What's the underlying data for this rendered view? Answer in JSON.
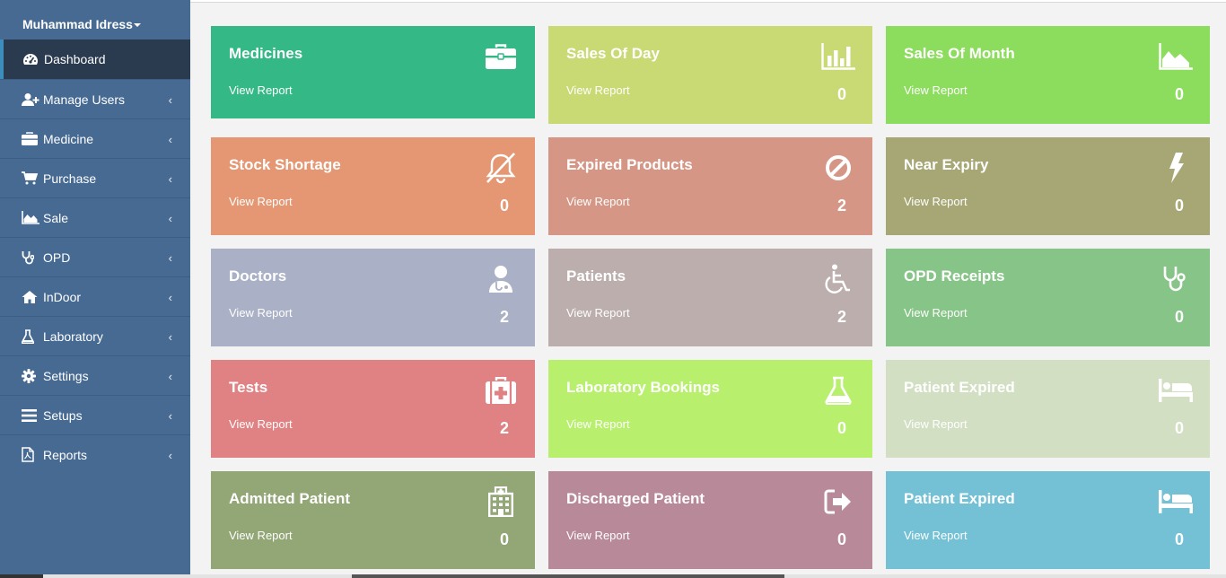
{
  "sidebar": {
    "user_name": "Muhammad Idress",
    "items": [
      {
        "label": "Dashboard",
        "icon": "dashboard-icon"
      },
      {
        "label": "Manage Users",
        "icon": "user-plus-icon"
      },
      {
        "label": "Medicine",
        "icon": "briefcase-icon"
      },
      {
        "label": "Purchase",
        "icon": "cart-icon"
      },
      {
        "label": "Sale",
        "icon": "area-chart-icon"
      },
      {
        "label": "OPD",
        "icon": "stethoscope-icon"
      },
      {
        "label": "InDoor",
        "icon": "home-icon"
      },
      {
        "label": "Laboratory",
        "icon": "flask-icon"
      },
      {
        "label": "Settings",
        "icon": "gear-icon"
      },
      {
        "label": "Setups",
        "icon": "bars-icon"
      },
      {
        "label": "Reports",
        "icon": "pdf-file-icon"
      }
    ]
  },
  "tiles": [
    {
      "title": "Medicines",
      "link": "View Report",
      "value": "",
      "color": "#33b886",
      "icon": "medkit-icon"
    },
    {
      "title": "Sales Of Day",
      "link": "View Report",
      "value": "0",
      "color": "#c9d974",
      "icon": "bar-chart-icon"
    },
    {
      "title": "Sales Of Month",
      "link": "View Report",
      "value": "0",
      "color": "#8cdc5e",
      "icon": "area-chart-icon"
    },
    {
      "title": "Stock Shortage",
      "link": "View Report",
      "value": "0",
      "color": "#e49772",
      "icon": "bell-slash-icon"
    },
    {
      "title": "Expired Products",
      "link": "View Report",
      "value": "2",
      "color": "#d59685",
      "icon": "ban-icon"
    },
    {
      "title": "Near Expiry",
      "link": "View Report",
      "value": "0",
      "color": "#a6a774",
      "icon": "bolt-icon"
    },
    {
      "title": "Doctors",
      "link": "View Report",
      "value": "2",
      "color": "#aab0c5",
      "icon": "user-md-icon"
    },
    {
      "title": "Patients",
      "link": "View Report",
      "value": "2",
      "color": "#bbaeac",
      "icon": "wheelchair-icon"
    },
    {
      "title": "OPD Receipts",
      "link": "View Report",
      "value": "0",
      "color": "#86c587",
      "icon": "stethoscope-icon"
    },
    {
      "title": "Tests",
      "link": "View Report",
      "value": "2",
      "color": "#e08283",
      "icon": "first-aid-icon"
    },
    {
      "title": "Laboratory Bookings",
      "link": "View Report",
      "value": "0",
      "color": "#b8f06e",
      "icon": "flask-icon"
    },
    {
      "title": "Patient Expired",
      "link": "View Report",
      "value": "0",
      "color": "#d2dfc3",
      "icon": "bed-icon"
    },
    {
      "title": "Admitted Patient",
      "link": "View Report",
      "value": "0",
      "color": "#92a676",
      "icon": "hospital-icon"
    },
    {
      "title": "Discharged Patient",
      "link": "View Report",
      "value": "0",
      "color": "#b88a99",
      "icon": "sign-out-icon"
    },
    {
      "title": "Patient Expired",
      "link": "View Report",
      "value": "0",
      "color": "#74c1d6",
      "icon": "bed-icon"
    }
  ]
}
